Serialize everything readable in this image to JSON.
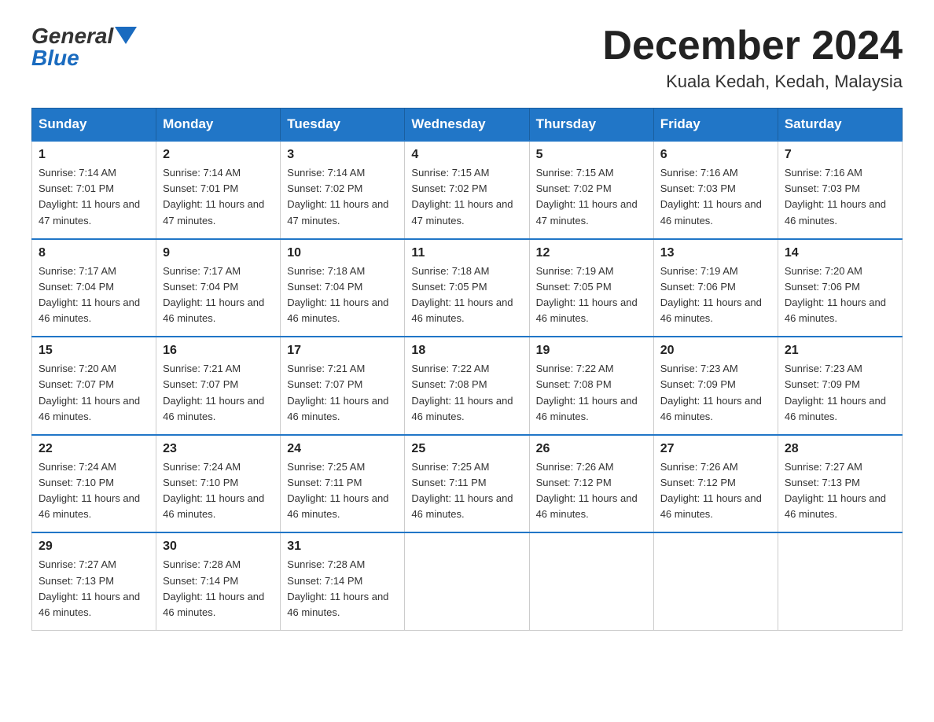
{
  "header": {
    "logo": {
      "text_general": "General",
      "text_blue": "Blue",
      "alt": "GeneralBlue logo"
    },
    "title": "December 2024",
    "location": "Kuala Kedah, Kedah, Malaysia"
  },
  "calendar": {
    "days_of_week": [
      "Sunday",
      "Monday",
      "Tuesday",
      "Wednesday",
      "Thursday",
      "Friday",
      "Saturday"
    ],
    "weeks": [
      [
        {
          "day": "1",
          "sunrise": "7:14 AM",
          "sunset": "7:01 PM",
          "daylight": "11 hours and 47 minutes."
        },
        {
          "day": "2",
          "sunrise": "7:14 AM",
          "sunset": "7:01 PM",
          "daylight": "11 hours and 47 minutes."
        },
        {
          "day": "3",
          "sunrise": "7:14 AM",
          "sunset": "7:02 PM",
          "daylight": "11 hours and 47 minutes."
        },
        {
          "day": "4",
          "sunrise": "7:15 AM",
          "sunset": "7:02 PM",
          "daylight": "11 hours and 47 minutes."
        },
        {
          "day": "5",
          "sunrise": "7:15 AM",
          "sunset": "7:02 PM",
          "daylight": "11 hours and 47 minutes."
        },
        {
          "day": "6",
          "sunrise": "7:16 AM",
          "sunset": "7:03 PM",
          "daylight": "11 hours and 46 minutes."
        },
        {
          "day": "7",
          "sunrise": "7:16 AM",
          "sunset": "7:03 PM",
          "daylight": "11 hours and 46 minutes."
        }
      ],
      [
        {
          "day": "8",
          "sunrise": "7:17 AM",
          "sunset": "7:04 PM",
          "daylight": "11 hours and 46 minutes."
        },
        {
          "day": "9",
          "sunrise": "7:17 AM",
          "sunset": "7:04 PM",
          "daylight": "11 hours and 46 minutes."
        },
        {
          "day": "10",
          "sunrise": "7:18 AM",
          "sunset": "7:04 PM",
          "daylight": "11 hours and 46 minutes."
        },
        {
          "day": "11",
          "sunrise": "7:18 AM",
          "sunset": "7:05 PM",
          "daylight": "11 hours and 46 minutes."
        },
        {
          "day": "12",
          "sunrise": "7:19 AM",
          "sunset": "7:05 PM",
          "daylight": "11 hours and 46 minutes."
        },
        {
          "day": "13",
          "sunrise": "7:19 AM",
          "sunset": "7:06 PM",
          "daylight": "11 hours and 46 minutes."
        },
        {
          "day": "14",
          "sunrise": "7:20 AM",
          "sunset": "7:06 PM",
          "daylight": "11 hours and 46 minutes."
        }
      ],
      [
        {
          "day": "15",
          "sunrise": "7:20 AM",
          "sunset": "7:07 PM",
          "daylight": "11 hours and 46 minutes."
        },
        {
          "day": "16",
          "sunrise": "7:21 AM",
          "sunset": "7:07 PM",
          "daylight": "11 hours and 46 minutes."
        },
        {
          "day": "17",
          "sunrise": "7:21 AM",
          "sunset": "7:07 PM",
          "daylight": "11 hours and 46 minutes."
        },
        {
          "day": "18",
          "sunrise": "7:22 AM",
          "sunset": "7:08 PM",
          "daylight": "11 hours and 46 minutes."
        },
        {
          "day": "19",
          "sunrise": "7:22 AM",
          "sunset": "7:08 PM",
          "daylight": "11 hours and 46 minutes."
        },
        {
          "day": "20",
          "sunrise": "7:23 AM",
          "sunset": "7:09 PM",
          "daylight": "11 hours and 46 minutes."
        },
        {
          "day": "21",
          "sunrise": "7:23 AM",
          "sunset": "7:09 PM",
          "daylight": "11 hours and 46 minutes."
        }
      ],
      [
        {
          "day": "22",
          "sunrise": "7:24 AM",
          "sunset": "7:10 PM",
          "daylight": "11 hours and 46 minutes."
        },
        {
          "day": "23",
          "sunrise": "7:24 AM",
          "sunset": "7:10 PM",
          "daylight": "11 hours and 46 minutes."
        },
        {
          "day": "24",
          "sunrise": "7:25 AM",
          "sunset": "7:11 PM",
          "daylight": "11 hours and 46 minutes."
        },
        {
          "day": "25",
          "sunrise": "7:25 AM",
          "sunset": "7:11 PM",
          "daylight": "11 hours and 46 minutes."
        },
        {
          "day": "26",
          "sunrise": "7:26 AM",
          "sunset": "7:12 PM",
          "daylight": "11 hours and 46 minutes."
        },
        {
          "day": "27",
          "sunrise": "7:26 AM",
          "sunset": "7:12 PM",
          "daylight": "11 hours and 46 minutes."
        },
        {
          "day": "28",
          "sunrise": "7:27 AM",
          "sunset": "7:13 PM",
          "daylight": "11 hours and 46 minutes."
        }
      ],
      [
        {
          "day": "29",
          "sunrise": "7:27 AM",
          "sunset": "7:13 PM",
          "daylight": "11 hours and 46 minutes."
        },
        {
          "day": "30",
          "sunrise": "7:28 AM",
          "sunset": "7:14 PM",
          "daylight": "11 hours and 46 minutes."
        },
        {
          "day": "31",
          "sunrise": "7:28 AM",
          "sunset": "7:14 PM",
          "daylight": "11 hours and 46 minutes."
        },
        null,
        null,
        null,
        null
      ]
    ]
  }
}
